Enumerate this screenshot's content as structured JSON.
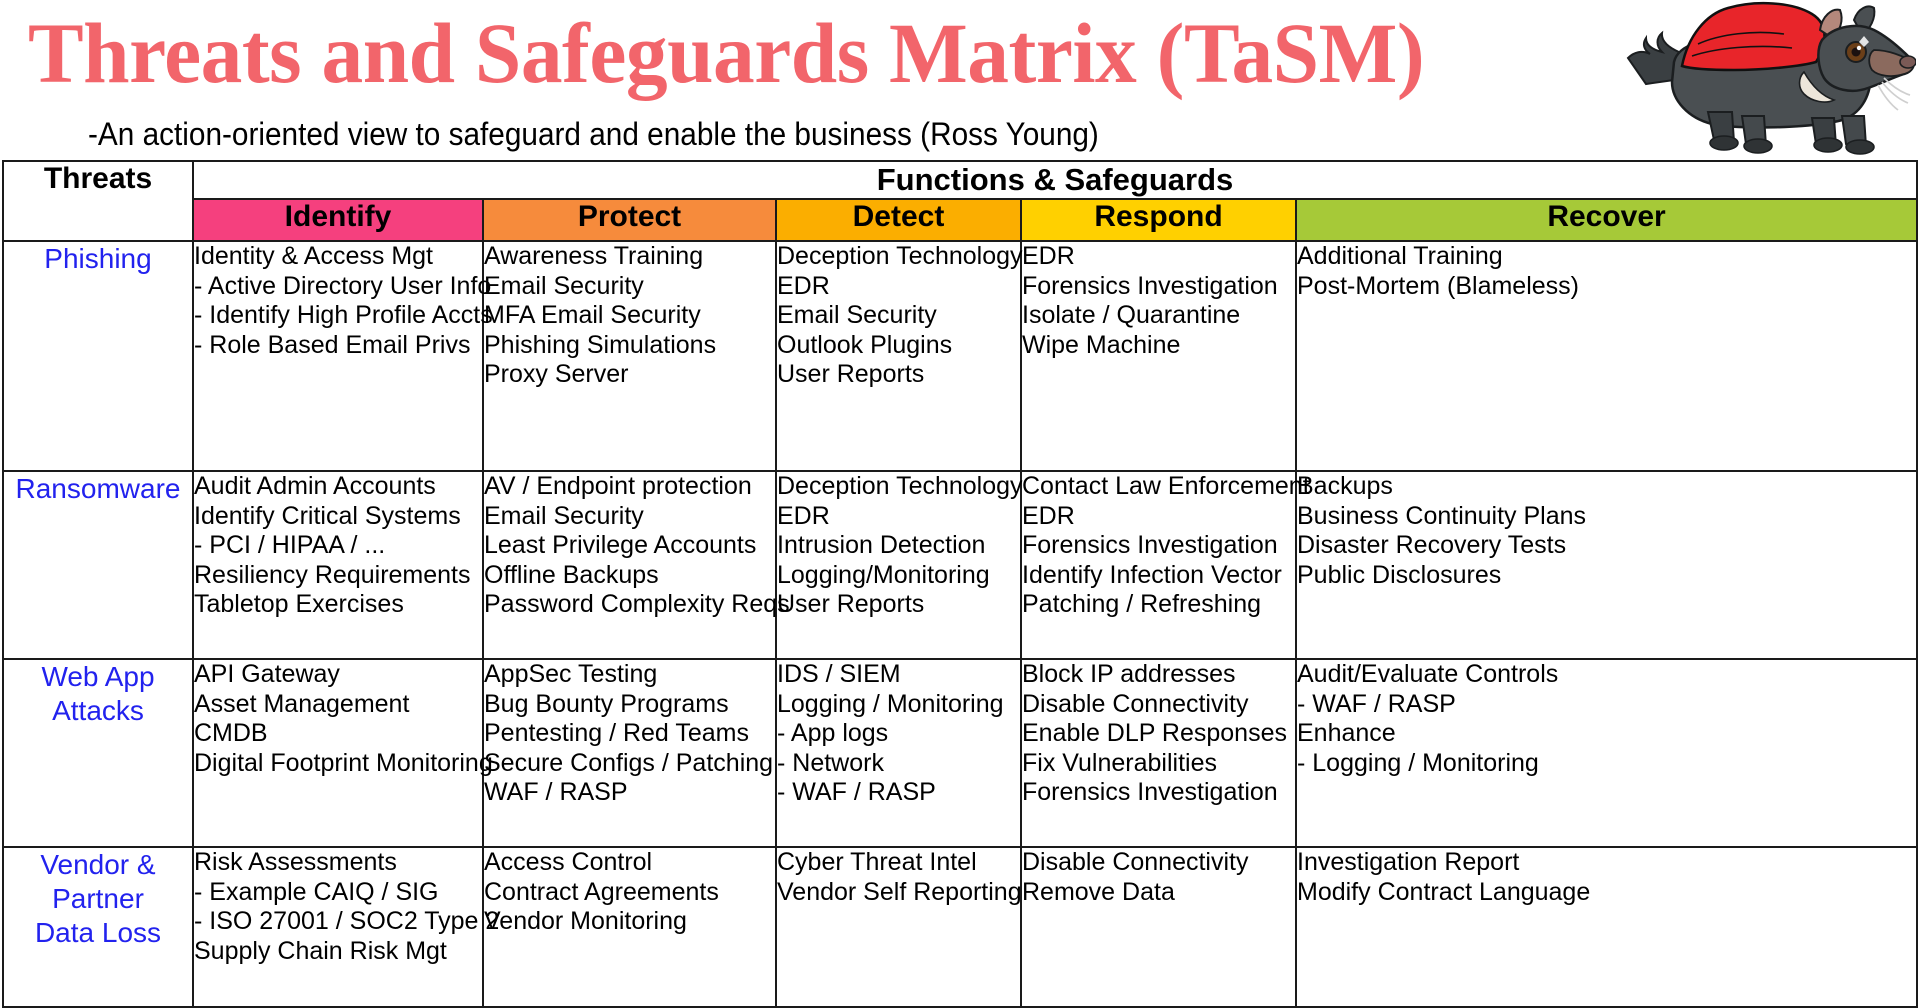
{
  "header": {
    "title": "Threats and Safeguards Matrix (TaSM)",
    "subtitle": "-An action-oriented view to safeguard and enable the business (Ross Young)",
    "title_color": "#F2656B",
    "mascot_icon": "tasmanian-devil-superhero-icon"
  },
  "table": {
    "threats_header": "Threats",
    "functions_header": "Functions & Safeguards",
    "functions": [
      {
        "label": "Identify",
        "color": "#F5407E"
      },
      {
        "label": "Protect",
        "color": "#F68B3C"
      },
      {
        "label": "Detect",
        "color": "#FBAE00"
      },
      {
        "label": "Respond",
        "color": "#FFD000"
      },
      {
        "label": "Recover",
        "color": "#A6C938"
      }
    ],
    "threat_color": "#2222EE",
    "rows": [
      {
        "threat_lines": [
          "Phishing"
        ],
        "identify": [
          "Identity & Access Mgt",
          "- Active Directory User Info",
          "- Identify High Profile Accts",
          "- Role Based Email Privs"
        ],
        "protect": [
          "Awareness Training",
          "Email Security",
          "MFA Email Security",
          "Phishing Simulations",
          "Proxy Server"
        ],
        "detect": [
          "Deception Technology",
          "EDR",
          "Email Security",
          "Outlook Plugins",
          "User Reports"
        ],
        "respond": [
          "EDR",
          "Forensics Investigation",
          "Isolate / Quarantine",
          "Wipe Machine"
        ],
        "recover": [
          "Additional Training",
          "Post-Mortem (Blameless)"
        ]
      },
      {
        "threat_lines": [
          "Ransomware"
        ],
        "identify": [
          "Audit Admin Accounts",
          "Identify Critical Systems",
          "- PCI / HIPAA / ...",
          "Resiliency Requirements",
          "Tabletop Exercises"
        ],
        "protect": [
          "AV / Endpoint protection",
          "Email Security",
          "Least Privilege Accounts",
          "Offline Backups",
          "Password Complexity Reqs"
        ],
        "detect": [
          "Deception Technology",
          "EDR",
          "Intrusion Detection",
          "Logging/Monitoring",
          "User Reports"
        ],
        "respond": [
          "Contact Law Enforcement",
          "EDR",
          "Forensics Investigation",
          "Identify Infection Vector",
          "Patching / Refreshing"
        ],
        "recover": [
          "Backups",
          "Business Continuity Plans",
          "Disaster Recovery Tests",
          "Public Disclosures"
        ]
      },
      {
        "threat_lines": [
          "Web App",
          "Attacks"
        ],
        "identify": [
          "API Gateway",
          "Asset Management",
          "CMDB",
          "Digital Footprint Monitoring"
        ],
        "protect": [
          "AppSec Testing",
          "Bug Bounty Programs",
          "Pentesting / Red Teams",
          "Secure Configs / Patching",
          "WAF / RASP"
        ],
        "detect": [
          "IDS / SIEM",
          "Logging / Monitoring",
          "- App logs",
          "- Network",
          "- WAF / RASP"
        ],
        "respond": [
          "Block IP addresses",
          "Disable Connectivity",
          "Enable DLP Responses",
          "Fix Vulnerabilities",
          "Forensics Investigation"
        ],
        "recover": [
          "Audit/Evaluate Controls",
          "- WAF / RASP",
          "Enhance",
          "- Logging / Monitoring"
        ]
      },
      {
        "threat_lines": [
          "Vendor &",
          "Partner",
          "Data Loss"
        ],
        "identify": [
          "Risk Assessments",
          "- Example CAIQ / SIG",
          "- ISO 27001 / SOC2 Type 2",
          "Supply Chain Risk Mgt"
        ],
        "protect": [
          "Access Control",
          "Contract Agreements",
          "Vendor Monitoring"
        ],
        "detect": [
          "Cyber Threat Intel",
          "Vendor Self Reporting"
        ],
        "respond": [
          "Disable Connectivity",
          "Remove Data"
        ],
        "recover": [
          "Investigation Report",
          "Modify Contract Language"
        ]
      }
    ]
  }
}
